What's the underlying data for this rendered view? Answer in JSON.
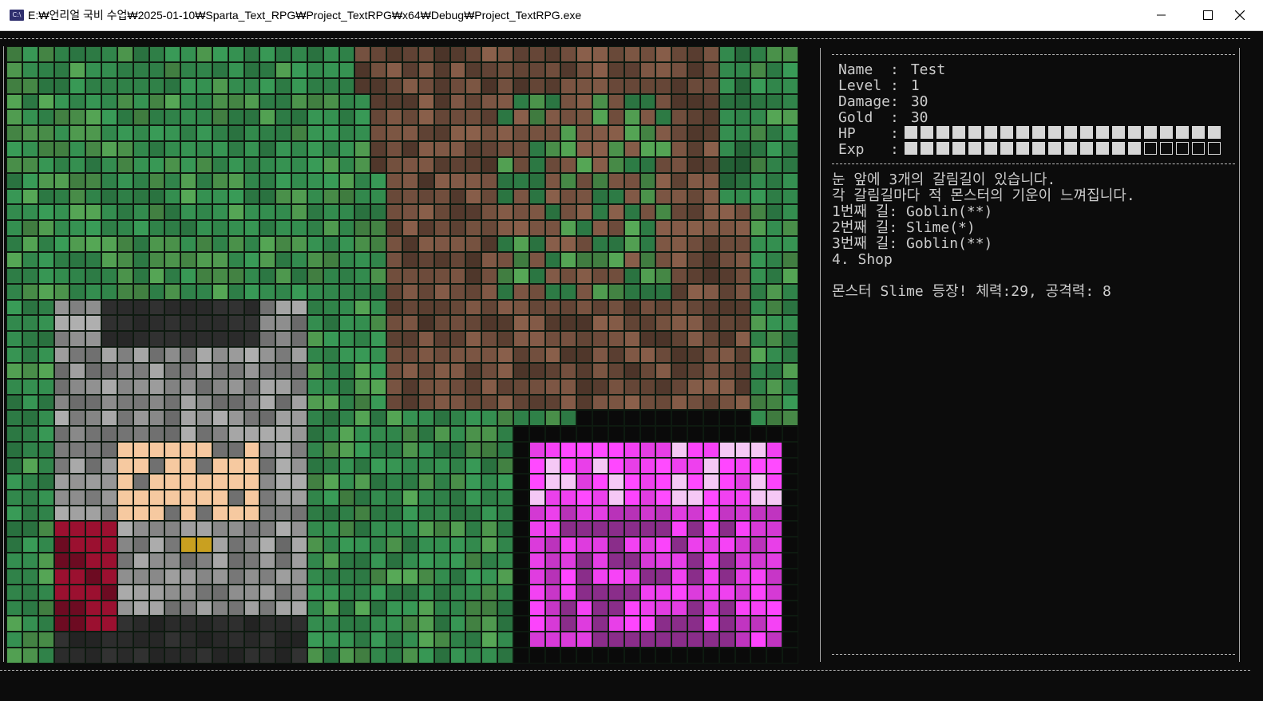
{
  "window": {
    "title": "E:₩언리얼 국비 수업₩2025-01-10₩Sparta_Text_RPG₩Project_TextRPG₩x64₩Debug₩Project_TextRPG.exe",
    "icon_text": "C:\\",
    "controls": [
      "minimize-icon",
      "maximize-icon",
      "close-icon"
    ]
  },
  "stats": {
    "name_label": "Name  :",
    "name_value": "Test",
    "level_label": "Level :",
    "level_value": "1",
    "damage_label": "Damage:",
    "damage_value": "30",
    "gold_label": "Gold  :",
    "gold_value": "30",
    "hp_label": "HP    :",
    "hp_filled": 20,
    "hp_total": 20,
    "exp_label": "Exp   :",
    "exp_filled": 15,
    "exp_total": 20
  },
  "messages": [
    "눈 앞에 3개의 갈림길이 있습니다.",
    "각 갈림길마다 적 몬스터의 기운이 느껴집니다.",
    "1번째 길: Goblin(**)",
    "2번째 길: Slime(*)",
    "3번째 길: Goblin(**)",
    "4. Shop",
    "",
    "몬스터 Slime 등장! 체력:29, 공격력: 8"
  ],
  "scene": {
    "icons": [
      "hero-sprite",
      "slime-sprite"
    ],
    "colors": {
      "grass": "#2e7d46",
      "grass_light": "#4f9a4f",
      "dirt": "#6b4a3a",
      "armor": "#8c8c8c",
      "skin": "#f6c9a0",
      "cape": "#9b1030",
      "slime": "#d63ad6",
      "slime_dark": "#8a2d8a",
      "slime_light": "#f5c8f5",
      "outline": "#0a0a0a"
    }
  }
}
